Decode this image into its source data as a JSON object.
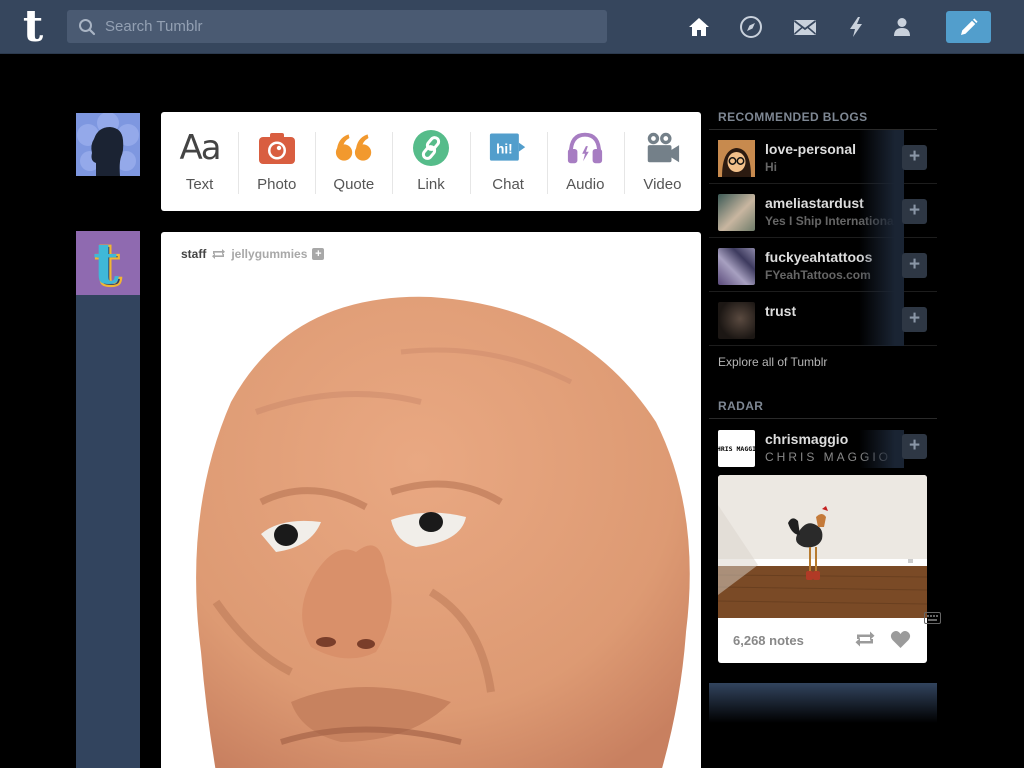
{
  "header": {
    "logo_letter": "t",
    "search_placeholder": "Search Tumblr",
    "nav_icons": [
      "home-icon",
      "explore-compass-icon",
      "inbox-mail-icon",
      "activity-lightning-icon",
      "account-person-icon"
    ],
    "compose_icon": "pencil-icon",
    "colors": {
      "bar": "#36465d",
      "search": "#4a5a72",
      "compose": "#529ecc"
    }
  },
  "composer": {
    "types": [
      {
        "label": "Text",
        "icon": "text-aa-icon",
        "color": "#444444"
      },
      {
        "label": "Photo",
        "icon": "camera-icon",
        "color": "#d95e40"
      },
      {
        "label": "Quote",
        "icon": "quote-icon",
        "color": "#f2992e"
      },
      {
        "label": "Link",
        "icon": "link-icon",
        "color": "#56bc8a"
      },
      {
        "label": "Chat",
        "icon": "chat-hi-icon",
        "color": "#529ecc",
        "icon_text": "hi!"
      },
      {
        "label": "Audio",
        "icon": "headphones-icon",
        "color": "#a77dc2"
      },
      {
        "label": "Video",
        "icon": "video-camera-icon",
        "color": "#748089"
      }
    ]
  },
  "post": {
    "author": "staff",
    "reblogged_from": "jellygummies",
    "follow_symbol": "+"
  },
  "sidebar": {
    "recommended_heading": "RECOMMENDED BLOGS",
    "blogs": [
      {
        "name": "love-personal",
        "title": "Hi"
      },
      {
        "name": "ameliastardust",
        "title": "Yes I Ship International"
      },
      {
        "name": "fuckyeahtattoos",
        "title": "FYeahTattoos.com"
      },
      {
        "name": "trust",
        "title": ""
      }
    ],
    "follow_symbol": "+",
    "explore_link": "Explore all of Tumblr",
    "radar_heading": "RADAR",
    "radar": {
      "name": "chrismaggio",
      "title": "CHRIS MAGGIO",
      "avatar_text": "CHRIS MAGGIO",
      "notes": "6,268 notes"
    }
  }
}
